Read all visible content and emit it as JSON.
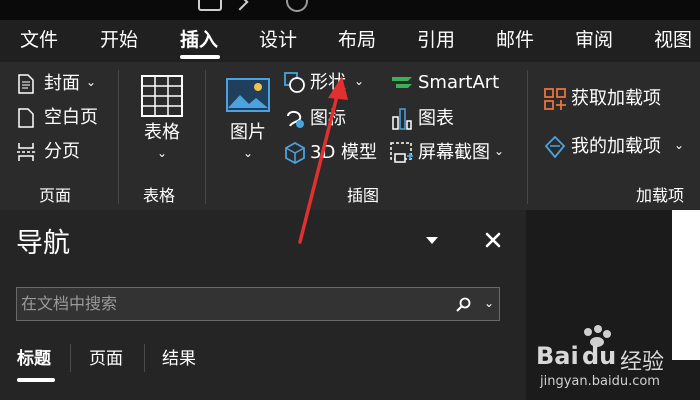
{
  "tabs": {
    "file": "文件",
    "home": "开始",
    "insert": "插入",
    "design": "设计",
    "layout": "布局",
    "references": "引用",
    "mailings": "邮件",
    "review": "审阅",
    "view": "视图"
  },
  "ribbon": {
    "pages": {
      "cover": "封面",
      "blank": "空白页",
      "break": "分页",
      "group": "页面"
    },
    "tables": {
      "table": "表格",
      "group": "表格"
    },
    "illustrations": {
      "pictures": "图片",
      "shapes": "形状",
      "icons": "图标",
      "models3d": "3D 模型",
      "smartart": "SmartArt",
      "chart": "图表",
      "screenshot": "屏幕截图",
      "group": "插图"
    },
    "addins": {
      "get": "获取加载项",
      "my": "我的加载项",
      "group": "加载项"
    }
  },
  "nav": {
    "title": "导航",
    "search_placeholder": "在文档中搜索",
    "tabs": [
      "标题",
      "页面",
      "结果"
    ]
  },
  "watermark": {
    "brand": "Bai",
    "brand2": "经验",
    "url": "jingyan.baidu.com"
  },
  "colors": {
    "accent_red": "#e03030",
    "icon_blue": "#4aa3df",
    "addin_orange": "#e8743b"
  }
}
